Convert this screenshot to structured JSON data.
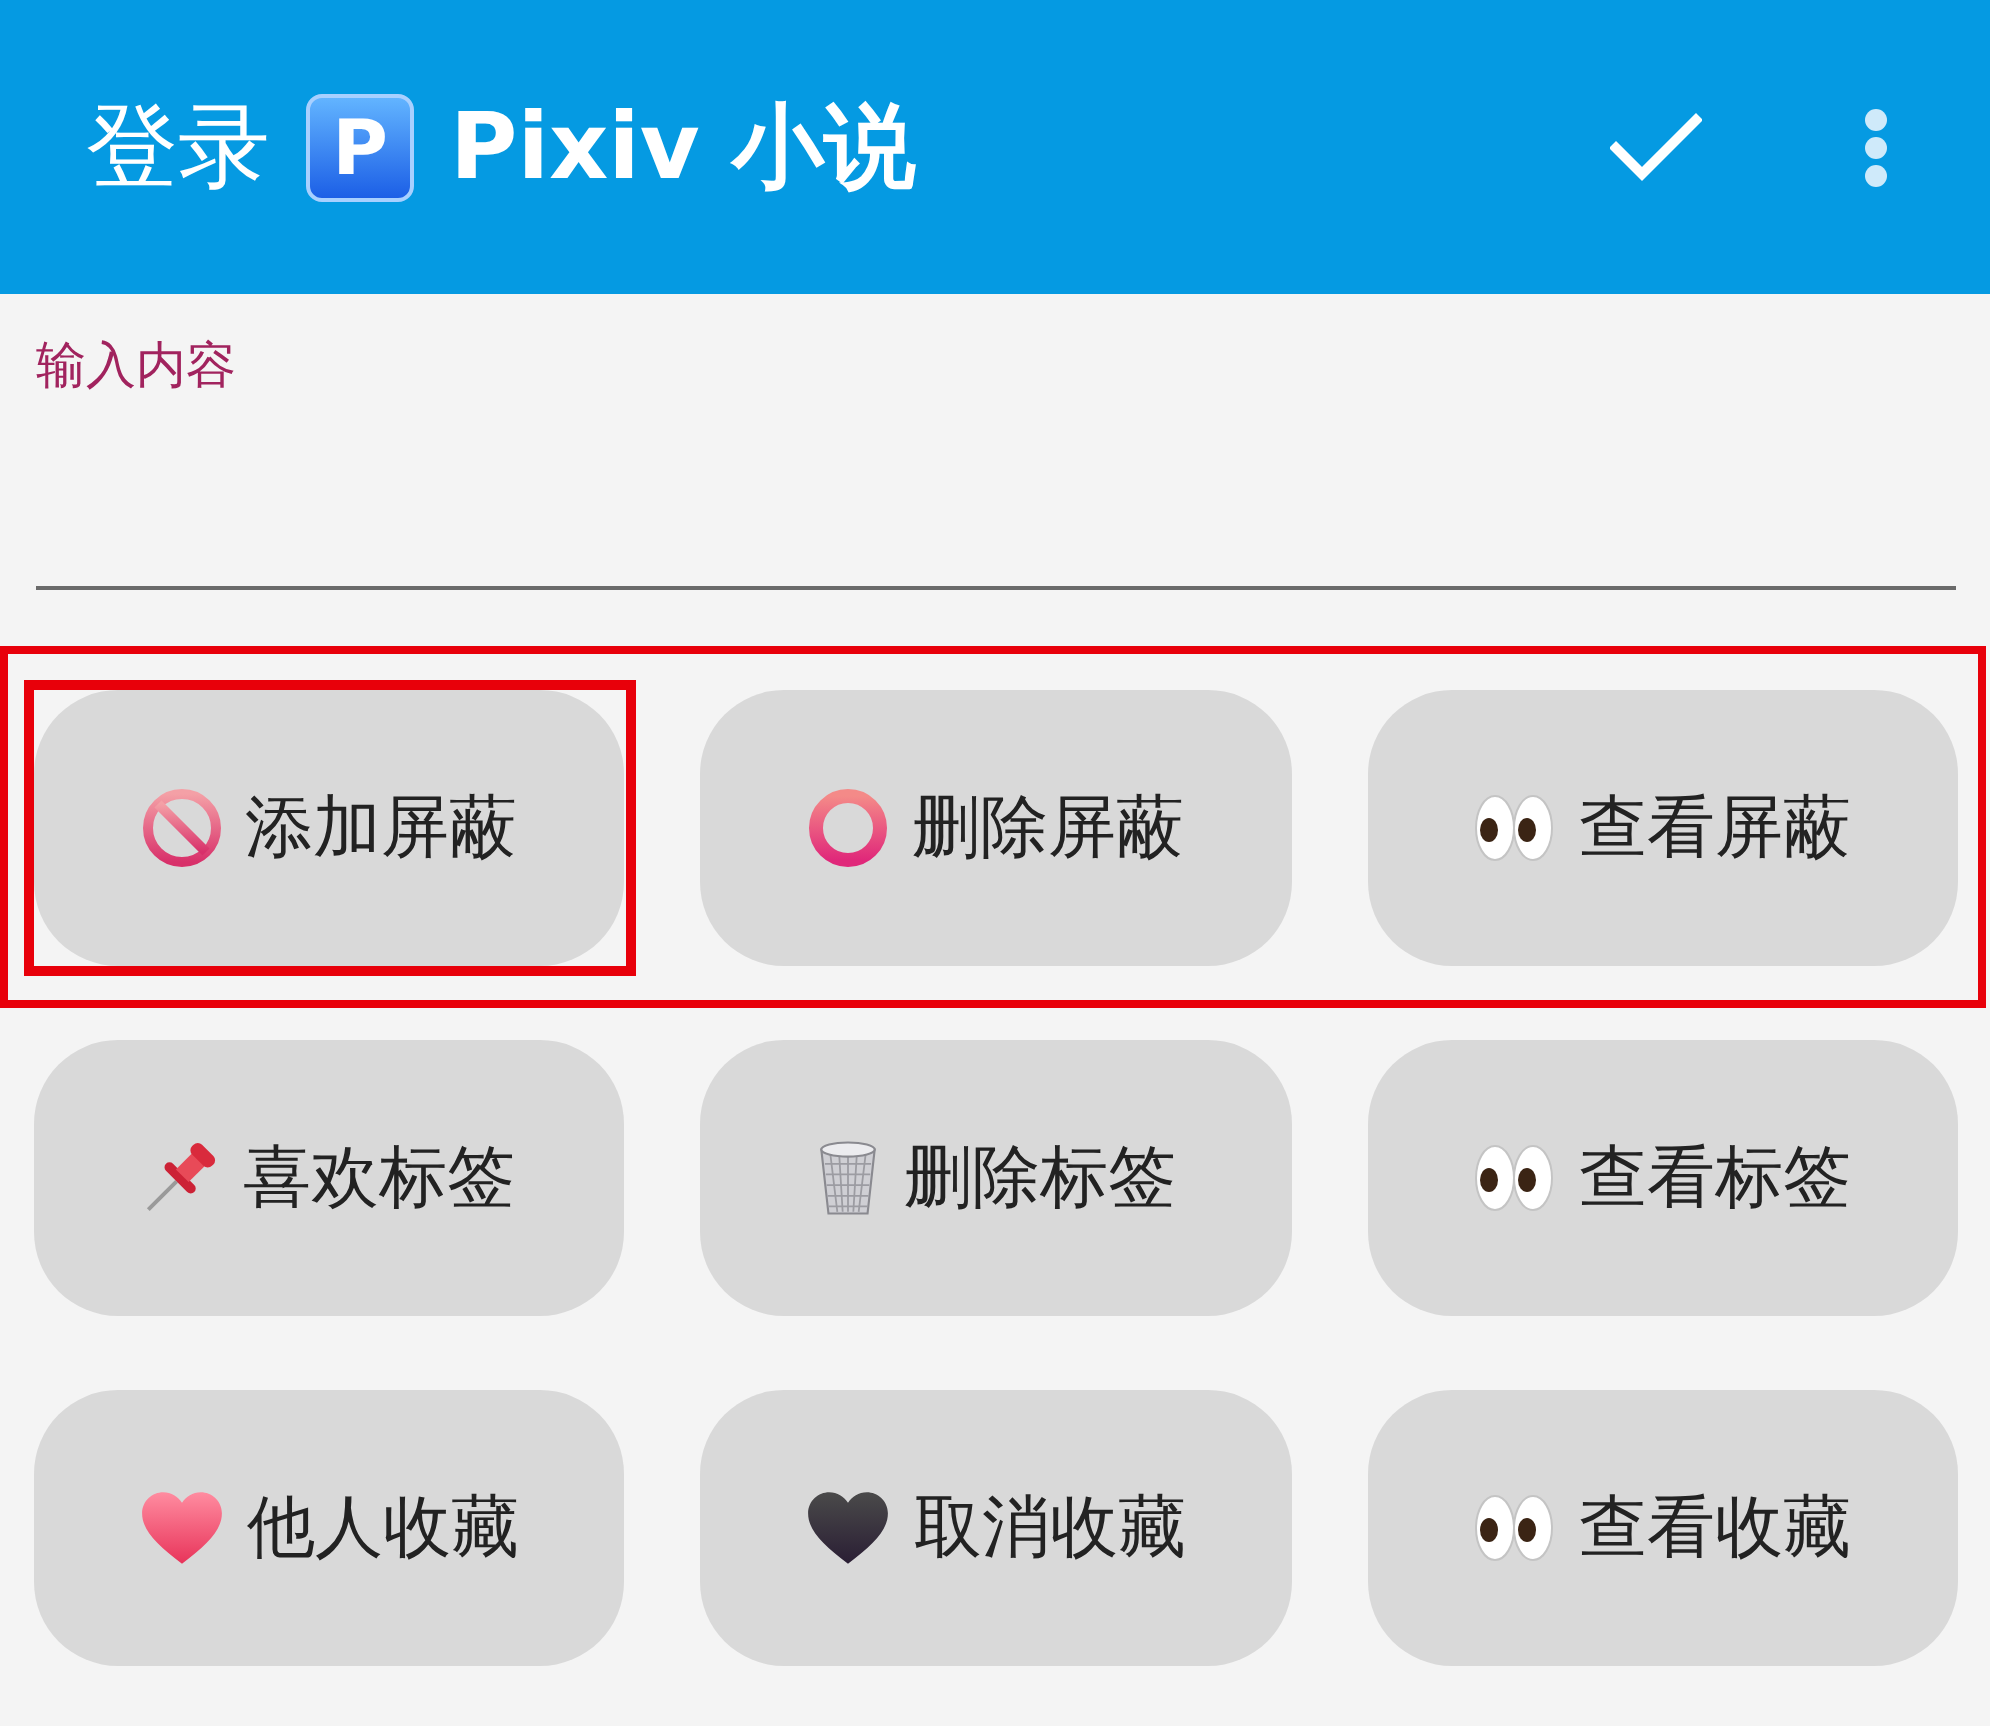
{
  "app_bar": {
    "title_start": "登录",
    "badge": "P",
    "title_end": "Pixiv 小说"
  },
  "input": {
    "label": "输入内容",
    "focused": true
  },
  "button_rows": [
    {
      "highlighted": true,
      "buttons": [
        {
          "kind": "prohibited",
          "label": "添加屏蔽",
          "highlighted": true
        },
        {
          "kind": "ring",
          "label": "删除屏蔽",
          "highlighted": false
        },
        {
          "kind": "eyes",
          "label": "查看屏蔽",
          "highlighted": false
        }
      ]
    },
    {
      "highlighted": false,
      "buttons": [
        {
          "kind": "pin",
          "label": "喜欢标签",
          "highlighted": false
        },
        {
          "kind": "trash",
          "label": "删除标签",
          "highlighted": false
        },
        {
          "kind": "eyes",
          "label": "查看标签",
          "highlighted": false
        }
      ]
    },
    {
      "highlighted": false,
      "buttons": [
        {
          "kind": "heart",
          "label": "他人收藏",
          "highlighted": false
        },
        {
          "kind": "dark_heart",
          "label": "取消收藏",
          "highlighted": false
        },
        {
          "kind": "eyes",
          "label": "查看收藏",
          "highlighted": false
        }
      ]
    }
  ]
}
